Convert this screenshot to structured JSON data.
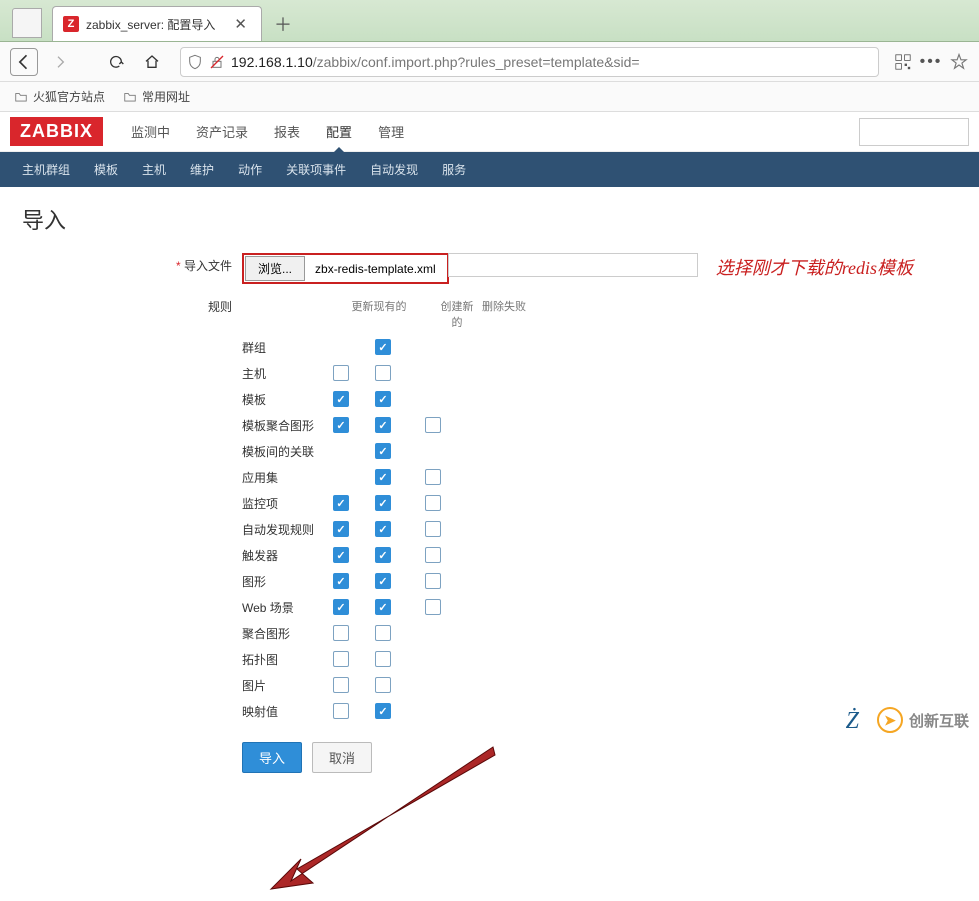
{
  "browser": {
    "tab_icon_letter": "Z",
    "tab_title": "zabbix_server: 配置导入",
    "url_prefix": "192.168.1.10",
    "url_path": "/zabbix/conf.import.php?rules_preset=template&sid=",
    "bookmarks": [
      {
        "label": "火狐官方站点"
      },
      {
        "label": "常用网址"
      }
    ]
  },
  "zabbix": {
    "logo": "ZABBIX",
    "main_nav": [
      "监测中",
      "资产记录",
      "报表",
      "配置",
      "管理"
    ],
    "main_nav_active": 3,
    "sub_nav": [
      "主机群组",
      "模板",
      "主机",
      "维护",
      "动作",
      "关联项事件",
      "自动发现",
      "服务"
    ]
  },
  "page": {
    "title": "导入",
    "file_label": "导入文件",
    "browse_label": "浏览...",
    "file_name": "zbx-redis-template.xml",
    "annotation": "选择刚才下载的redis模板",
    "rules_label": "规则",
    "col_update": "更新现有的",
    "col_create": "创建新的",
    "col_delete": "删除失败",
    "rules": [
      {
        "name": "群组",
        "update": null,
        "create": true,
        "delete": null
      },
      {
        "name": "主机",
        "update": false,
        "create": false,
        "delete": null
      },
      {
        "name": "模板",
        "update": true,
        "create": true,
        "delete": null
      },
      {
        "name": "模板聚合图形",
        "update": true,
        "create": true,
        "delete": false
      },
      {
        "name": "模板间的关联",
        "update": null,
        "create": true,
        "delete": null
      },
      {
        "name": "应用集",
        "update": null,
        "create": true,
        "delete": false
      },
      {
        "name": "监控项",
        "update": true,
        "create": true,
        "delete": false
      },
      {
        "name": "自动发现规则",
        "update": true,
        "create": true,
        "delete": false
      },
      {
        "name": "触发器",
        "update": true,
        "create": true,
        "delete": false
      },
      {
        "name": "图形",
        "update": true,
        "create": true,
        "delete": false
      },
      {
        "name": "Web 场景",
        "update": true,
        "create": true,
        "delete": false
      },
      {
        "name": "聚合图形",
        "update": false,
        "create": false,
        "delete": null
      },
      {
        "name": "拓扑图",
        "update": false,
        "create": false,
        "delete": null
      },
      {
        "name": "图片",
        "update": false,
        "create": false,
        "delete": null
      },
      {
        "name": "映射值",
        "update": false,
        "create": true,
        "delete": null
      }
    ],
    "submit_label": "导入",
    "cancel_label": "取消"
  },
  "watermark": "创新互联"
}
